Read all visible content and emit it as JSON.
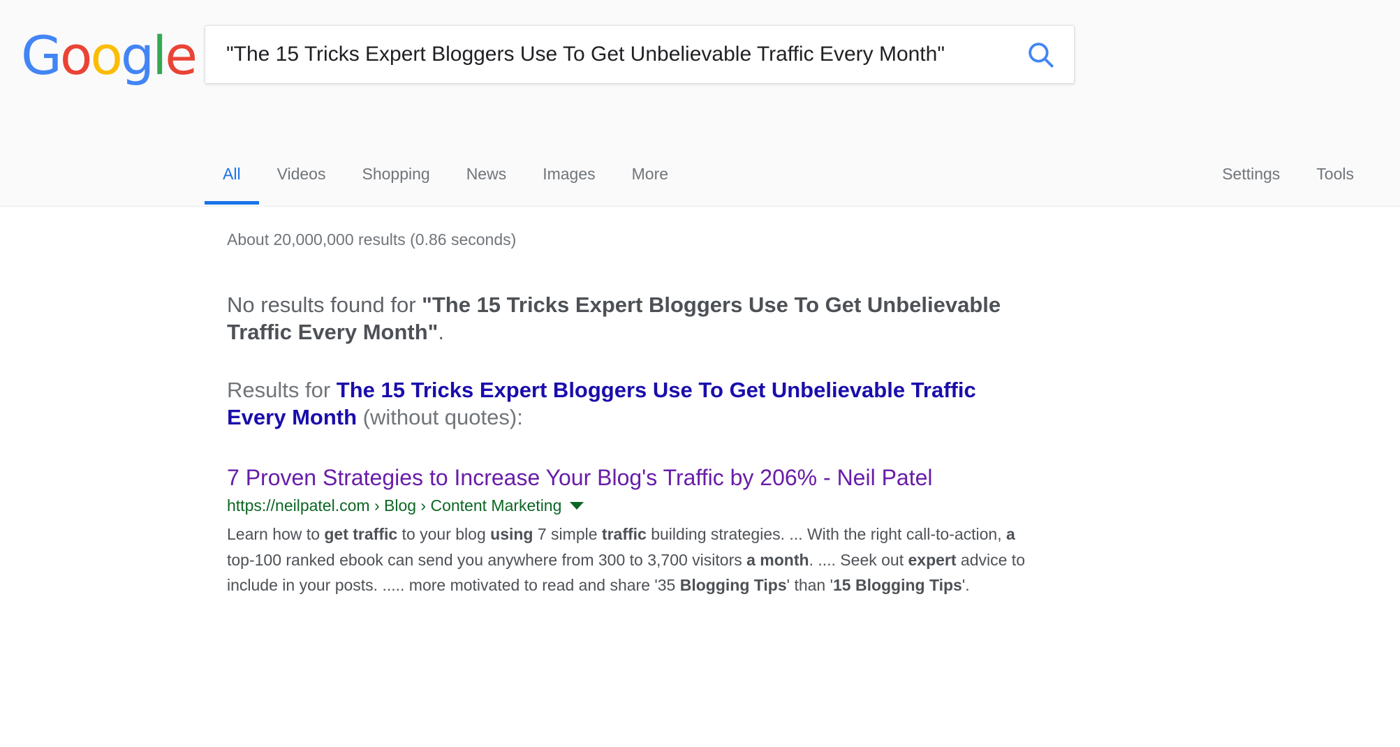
{
  "branding": {
    "logo_letters": [
      "G",
      "o",
      "o",
      "g",
      "l",
      "e"
    ]
  },
  "search": {
    "query": "\"The 15 Tricks Expert Bloggers Use To Get Unbelievable Traffic Every Month\"",
    "placeholder": "Search",
    "search_icon": "search-icon",
    "accent_color": "#4285f4"
  },
  "nav": {
    "left_items": [
      {
        "label": "All",
        "active": true
      },
      {
        "label": "Videos",
        "active": false
      },
      {
        "label": "Shopping",
        "active": false
      },
      {
        "label": "News",
        "active": false
      },
      {
        "label": "Images",
        "active": false
      },
      {
        "label": "More",
        "active": false
      }
    ],
    "right_items": [
      {
        "label": "Settings"
      },
      {
        "label": "Tools"
      }
    ],
    "active_color": "#1a73e8"
  },
  "main": {
    "result_stats": "About 20,000,000 results (0.86 seconds)",
    "no_results": {
      "prefix": "No results found for ",
      "quoted_query": "\"The 15 Tricks Expert Bloggers Use To Get Unbelievable Traffic Every Month\"",
      "suffix": "."
    },
    "results_for": {
      "prefix": "Results for ",
      "query_link": "The 15 Tricks Expert Bloggers Use To Get Unbelievable Traffic Every Month",
      "suffix": " (without quotes):"
    },
    "results": [
      {
        "title": "7 Proven Strategies to Increase Your Blog's Traffic by 206% - Neil Patel",
        "url": "https://neilpatel.com › Blog › Content Marketing",
        "snippet_parts": [
          {
            "text": "Learn how to ",
            "bold": false
          },
          {
            "text": "get traffic",
            "bold": true
          },
          {
            "text": " to your blog ",
            "bold": false
          },
          {
            "text": "using",
            "bold": true
          },
          {
            "text": " 7 simple ",
            "bold": false
          },
          {
            "text": "traffic",
            "bold": true
          },
          {
            "text": " building strategies. ... With the right call-to-action, ",
            "bold": false
          },
          {
            "text": "a",
            "bold": true
          },
          {
            "text": " top-100 ranked ebook can send you anywhere from 300 to 3,700 visitors ",
            "bold": false
          },
          {
            "text": "a month",
            "bold": true
          },
          {
            "text": ". .... Seek out ",
            "bold": false
          },
          {
            "text": "expert",
            "bold": true
          },
          {
            "text": " advice to include in your posts. ..... more motivated to read and share '35 ",
            "bold": false
          },
          {
            "text": "Blogging Tips",
            "bold": true
          },
          {
            "text": "' than '",
            "bold": false
          },
          {
            "text": "15 Blogging Tips",
            "bold": true
          },
          {
            "text": "'.",
            "bold": false
          }
        ]
      }
    ],
    "colors": {
      "title_link": "#681da8",
      "url": "#0b6623",
      "query_link": "#1a0dab",
      "body_text": "#4d5156"
    }
  }
}
